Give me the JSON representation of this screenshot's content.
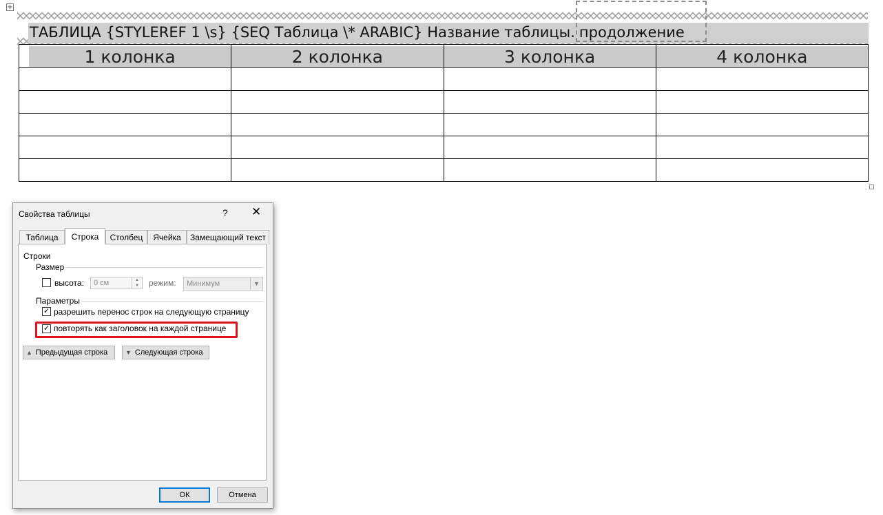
{
  "document": {
    "caption_field": "ТАБЛИЦА {STYLEREF 1 \\s} {SEQ Таблица \\* ARABIC} Название таблицы.",
    "caption_continuation": "продолжение",
    "table_headers": [
      "1 колонка",
      "2 колонка",
      "3 колонка",
      "4 колонка"
    ],
    "empty_rows": 5,
    "move_handle_icon": "move-icon"
  },
  "dialog": {
    "title": "Свойства таблицы",
    "help": "?",
    "close": "✕",
    "tabs": [
      {
        "label": "Таблица",
        "active": false
      },
      {
        "label": "Строка",
        "active": true
      },
      {
        "label": "Столбец",
        "active": false
      },
      {
        "label": "Ячейка",
        "active": false
      },
      {
        "label": "Замещающий текст",
        "active": false
      }
    ],
    "section_rows": "Строки",
    "group_size": "Размер",
    "height_label": "высота:",
    "height_checked": false,
    "height_value": "0 см",
    "mode_label": "режим:",
    "mode_value": "Минимум",
    "group_params": "Параметры",
    "allow_break_label": "разрешить перенос строк на следующую страницу",
    "allow_break_checked": true,
    "repeat_header_label": "повторять как заголовок на каждой странице",
    "repeat_header_checked": true,
    "prev_row_button": "Предыдущая строка",
    "next_row_button": "Следующая строка",
    "ok_button": "ОК",
    "cancel_button": "Отмена",
    "highlight_color": "#e0141c"
  }
}
